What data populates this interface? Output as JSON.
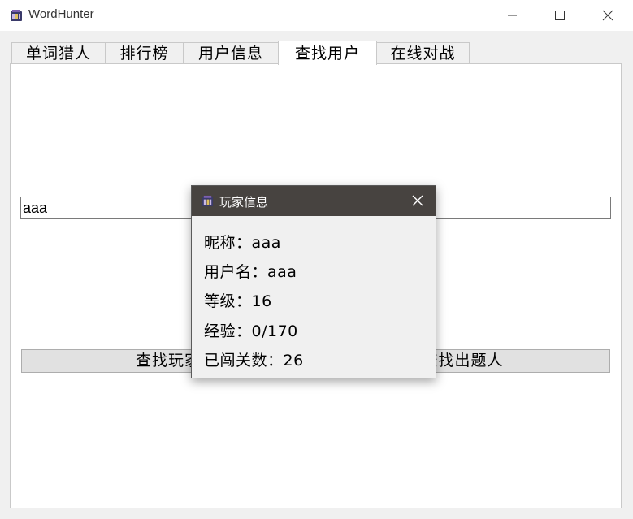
{
  "window": {
    "title": "WordHunter"
  },
  "tabs": [
    {
      "label": "单词猎人"
    },
    {
      "label": "排行榜"
    },
    {
      "label": "用户信息"
    },
    {
      "label": "查找用户"
    },
    {
      "label": "在线对战"
    }
  ],
  "active_tab": "查找用户",
  "search": {
    "value": "aaa"
  },
  "buttons": {
    "find_player_label": "查找玩家",
    "find_setter_label": "查找出题人"
  },
  "dialog": {
    "title": "玩家信息",
    "lines": [
      {
        "label": "昵称：",
        "value": "aaa"
      },
      {
        "label": "用户名：",
        "value": "aaa"
      },
      {
        "label": "等级：",
        "value": "16"
      },
      {
        "label": "经验：",
        "value": "0/170"
      },
      {
        "label": "已闯关数：",
        "value": "26"
      }
    ]
  },
  "colors": {
    "dialog_header": "#474340",
    "tab_border": "#c9c9c9",
    "button_bg": "#e1e1e1"
  },
  "icons": {
    "app": "wordhunter-app-icon",
    "minimize": "minimize-icon",
    "maximize": "maximize-icon",
    "close": "close-icon"
  }
}
